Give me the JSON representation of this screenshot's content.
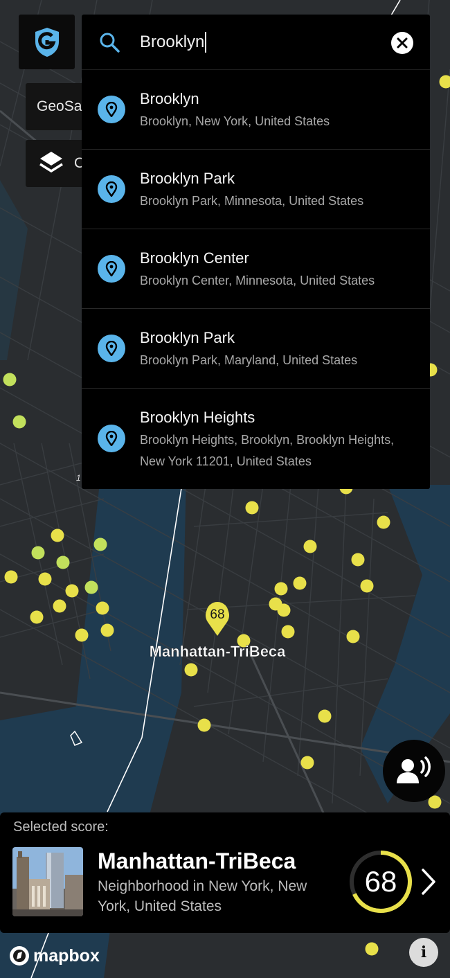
{
  "app": {
    "brand_chip_label": "GeoSa",
    "layers_chip_label": "C"
  },
  "search": {
    "query": "Brooklyn",
    "results": [
      {
        "title": "Brooklyn",
        "subtitle": "Brooklyn, New York, United States"
      },
      {
        "title": "Brooklyn Park",
        "subtitle": "Brooklyn Park, Minnesota, United States"
      },
      {
        "title": "Brooklyn Center",
        "subtitle": "Brooklyn Center, Minnesota, United States"
      },
      {
        "title": "Brooklyn Park",
        "subtitle": "Brooklyn Park, Maryland, United States"
      },
      {
        "title": "Brooklyn Heights",
        "subtitle": "Brooklyn Heights, Brooklyn, Brooklyn Heights, New York 11201, United States"
      }
    ]
  },
  "map": {
    "marker_score": "68",
    "marker_label": "Manhattan-TriBeca",
    "stray_label": "1"
  },
  "selected": {
    "label": "Selected score:",
    "name": "Manhattan-TriBeca",
    "description": "Neighborhood in New York, New York, United States",
    "score": "68",
    "score_fraction": 0.68
  },
  "footer": {
    "mapbox": "mapbox",
    "info": "i"
  },
  "colors": {
    "accent": "#5ab4ea",
    "score_yellow": "#e8e04a",
    "dot_green": "#c2e05c",
    "panel": "#000000",
    "water": "#1f3b50",
    "land": "#2a2d30"
  },
  "icons": {
    "logo": "geosafe-g-shield-icon",
    "layers": "layers-icon",
    "search": "search-icon",
    "clear": "close-circle-icon",
    "result": "location-pin-icon",
    "voice": "voice-speaker-icon",
    "next": "chevron-right-icon",
    "info": "info-icon"
  }
}
